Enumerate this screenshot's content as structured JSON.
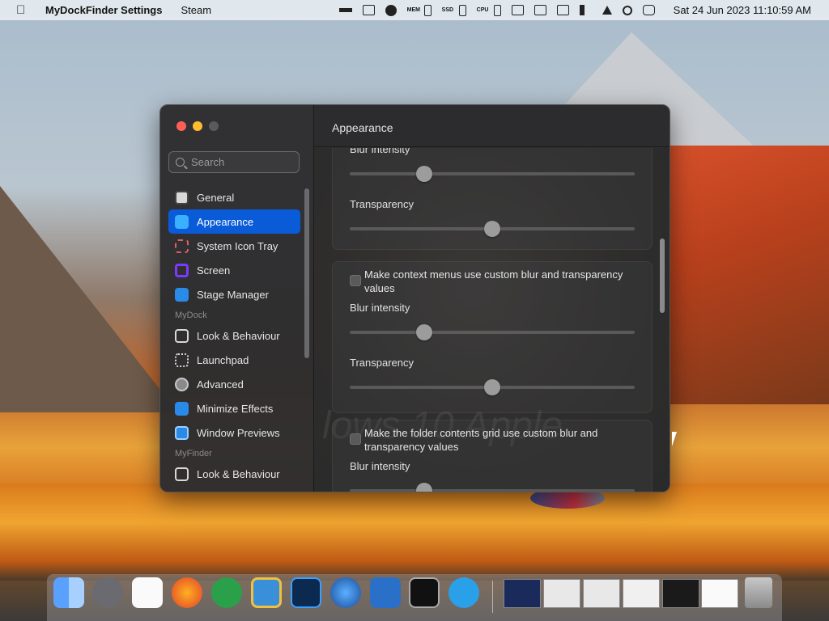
{
  "menubar": {
    "app_name": "MyDockFinder Settings",
    "menu_items": [
      "Steam"
    ],
    "clock": "Sat 24 Jun 2023 11:10:59 AM",
    "mem_label": "MEM",
    "ssd_label": "SSD",
    "cpu_label": "CPU"
  },
  "window": {
    "title": "Appearance",
    "search_placeholder": "Search",
    "nav": {
      "general": "General",
      "appearance": "Appearance",
      "system_icon_tray": "System Icon Tray",
      "screen": "Screen",
      "stage_manager": "Stage Manager",
      "section_mydock": "MyDock",
      "look_behaviour": "Look & Behaviour",
      "launchpad": "Launchpad",
      "advanced": "Advanced",
      "minimize_effects": "Minimize Effects",
      "window_previews": "Window Previews",
      "section_myfinder": "MyFinder",
      "look_behaviour_2": "Look & Behaviour"
    },
    "content": {
      "blur_intensity_1": "Blur intensity",
      "transparency_1": "Transparency",
      "context_menus_label": "Make context menus use custom blur and transparency values",
      "blur_intensity_2": "Blur intensity",
      "transparency_2": "Transparency",
      "folder_grid_label": "Make the folder contents grid use custom blur and transparency values",
      "blur_intensity_3": "Blur intensity",
      "background_ghost_text": "lows 10 Apple"
    },
    "sliders": {
      "blur_1": 0.26,
      "transparency_1": 0.5,
      "blur_2": 0.26,
      "transparency_2": 0.5,
      "blur_3": 0.26
    },
    "colors": {
      "selected": "#0a5bd8",
      "close": "#ff5f57",
      "minimize": "#febc2e"
    }
  },
  "dock": {
    "apps": [
      "finder-icon",
      "launchpad-rocket-icon",
      "help-icon",
      "firefox-icon",
      "utorrent-icon",
      "file-manager-icon",
      "photoshop-icon",
      "windows-icon",
      "powershell-icon",
      "terminal-icon",
      "internet-explorer-icon"
    ]
  }
}
